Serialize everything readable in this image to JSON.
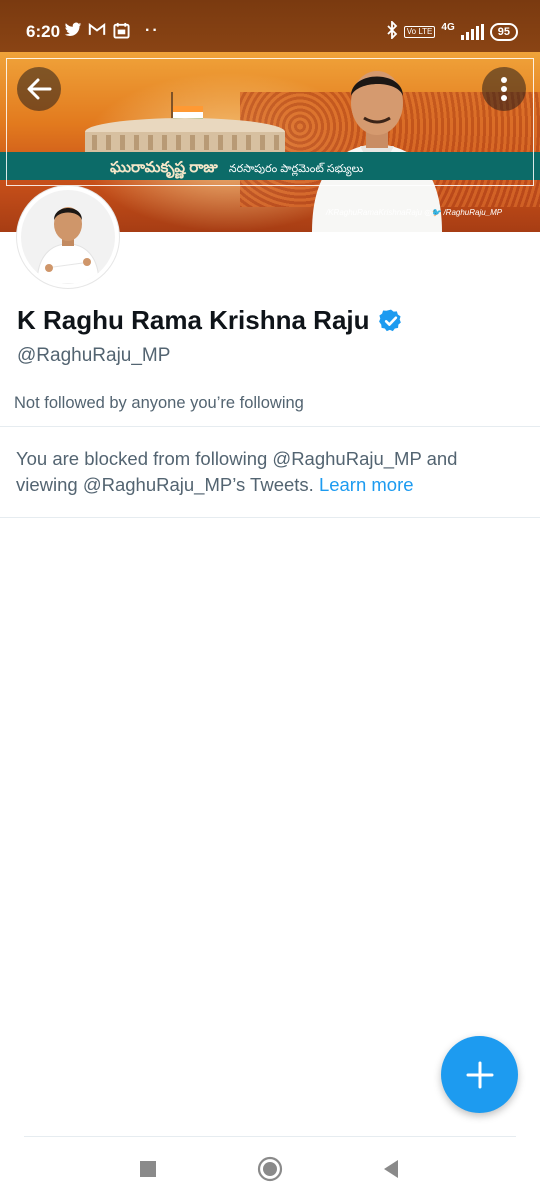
{
  "status_bar": {
    "time": "6:20",
    "icons": [
      "twitter-icon",
      "gmail-icon",
      "calendar-icon",
      "more-dots"
    ],
    "network": "4G",
    "volte": "Vo LTE",
    "battery": "95"
  },
  "banner": {
    "title_telugu": "ఘురామకృష్ణ రాజు",
    "subtitle_telugu": "నరసాపురం పార్లమెంట్ సభ్యులు",
    "social": "/KRaghuRamaKrishnaRaju  ◎🐦 /RaghuRaju_MP"
  },
  "profile": {
    "name": "K Raghu Rama Krishna Raju",
    "handle": "@RaghuRaju_MP",
    "followed_by": "Not followed by anyone you’re following",
    "verified": true
  },
  "blocked": {
    "message": "You are blocked from following @RaghuRaju_MP and viewing @RaghuRaju_MP’s Tweets. ",
    "link": "Learn more"
  },
  "colors": {
    "accent": "#1d9bf0",
    "secondary_text": "#536471",
    "banner_strip": "#0c6b68"
  }
}
